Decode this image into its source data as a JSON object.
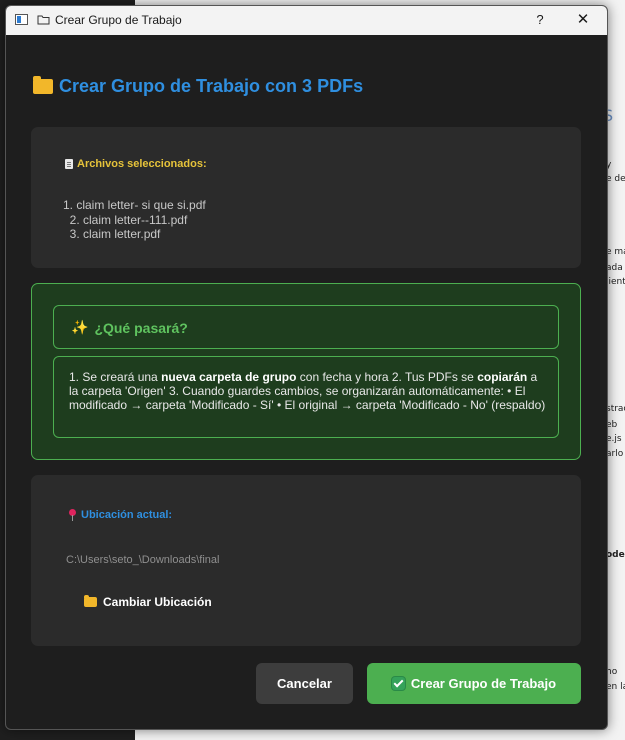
{
  "window": {
    "title": "Crear Grupo de Trabajo",
    "help_label": "?",
    "close_label": "✕"
  },
  "heading": "Crear Grupo de Trabajo con 3 PDFs",
  "files": {
    "label": "Archivos seleccionados:",
    "items": [
      "1. claim letter- si que si.pdf",
      "  2. claim letter--111.pdf",
      "  3. claim letter.pdf"
    ]
  },
  "info": {
    "title": "¿Qué pasará?",
    "text_parts": [
      "1. Se creará una ",
      "nueva carpeta de grupo",
      " con fecha y hora 2. Tus PDFs se ",
      "copiarán",
      " a la carpeta 'Origen' 3. Cuando guardes cambios, se organizarán automáticamente: • El modificado → carpeta 'Modificado - Sí' • El original → carpeta 'Modificado - No' (respaldo)"
    ]
  },
  "location": {
    "label": "Ubicación actual:",
    "path": "C:\\Users\\seto_\\Downloads\\final",
    "change_label": "Cambiar Ubicación"
  },
  "buttons": {
    "cancel": "Cancelar",
    "create": "Crear Grupo de Trabajo"
  },
  "background": {
    "fragments": [
      "S",
      "y",
      "e de",
      "e ma",
      "ada",
      "lient",
      "l",
      "strac",
      "eb",
      "e.js",
      "arlo",
      "l",
      "ode",
      "ho",
      "en la"
    ]
  },
  "colors": {
    "accent_blue": "#2f8fe0",
    "label_yellow": "#e6c33a",
    "green": "#4caf50",
    "green_panel": "#1e3d1e"
  }
}
